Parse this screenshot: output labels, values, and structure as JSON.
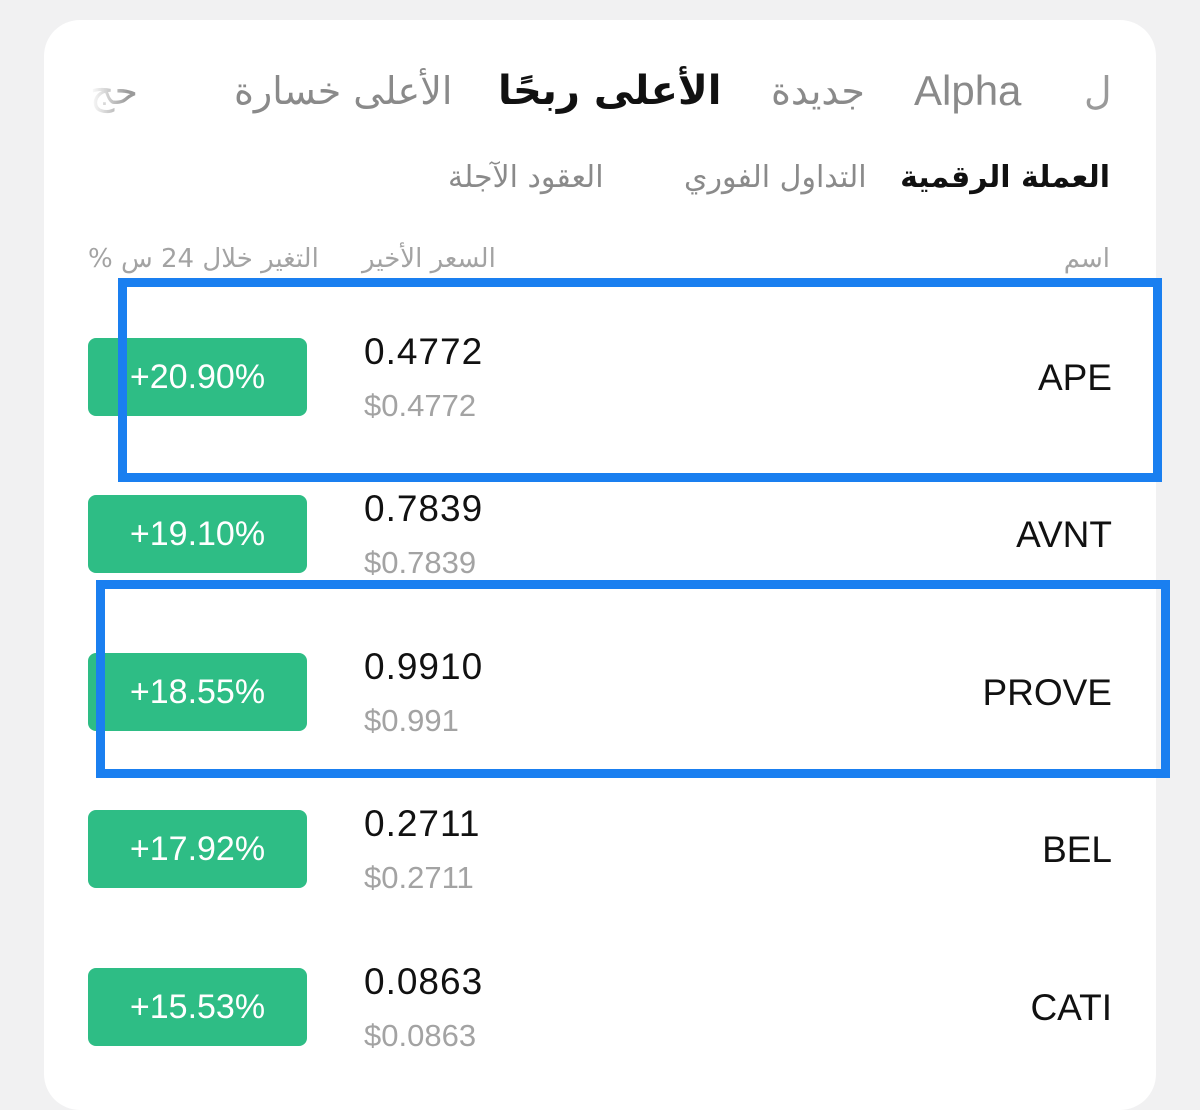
{
  "tabs": [
    {
      "label": "حج",
      "state": "partial"
    },
    {
      "label": "الأعلى خسارة",
      "state": "inactive"
    },
    {
      "label": "الأعلى ربحًا",
      "state": "active"
    },
    {
      "label": "جديدة",
      "state": "inactive"
    },
    {
      "label": "Alpha",
      "state": "inactive"
    },
    {
      "label": "ل",
      "state": "partial"
    }
  ],
  "subtabs": [
    {
      "label": "العقود الآجلة",
      "state": "inactive"
    },
    {
      "label": "التداول الفوري",
      "state": "inactive"
    },
    {
      "label": "العملة الرقمية",
      "state": "active"
    }
  ],
  "columns": {
    "change": "% التغير خلال 24 س",
    "last_price": "السعر الأخير",
    "name": "اسم"
  },
  "rows": [
    {
      "symbol": "APE",
      "price": "0.4772",
      "usd_price": "$0.4772",
      "change": "+20.90%",
      "highlighted": true
    },
    {
      "symbol": "AVNT",
      "price": "0.7839",
      "usd_price": "$0.7839",
      "change": "+19.10%",
      "highlighted": false
    },
    {
      "symbol": "PROVE",
      "price": "0.9910",
      "usd_price": "$0.991",
      "change": "+18.55%",
      "highlighted": true
    },
    {
      "symbol": "BEL",
      "price": "0.2711",
      "usd_price": "$0.2711",
      "change": "+17.92%",
      "highlighted": false
    },
    {
      "symbol": "CATI",
      "price": "0.0863",
      "usd_price": "$0.0863",
      "change": "+15.53%",
      "highlighted": false
    }
  ],
  "colors": {
    "positive": "#2ebd85",
    "highlight": "#1a7ff0",
    "background": "#f1f1f2",
    "card": "#ffffff"
  }
}
